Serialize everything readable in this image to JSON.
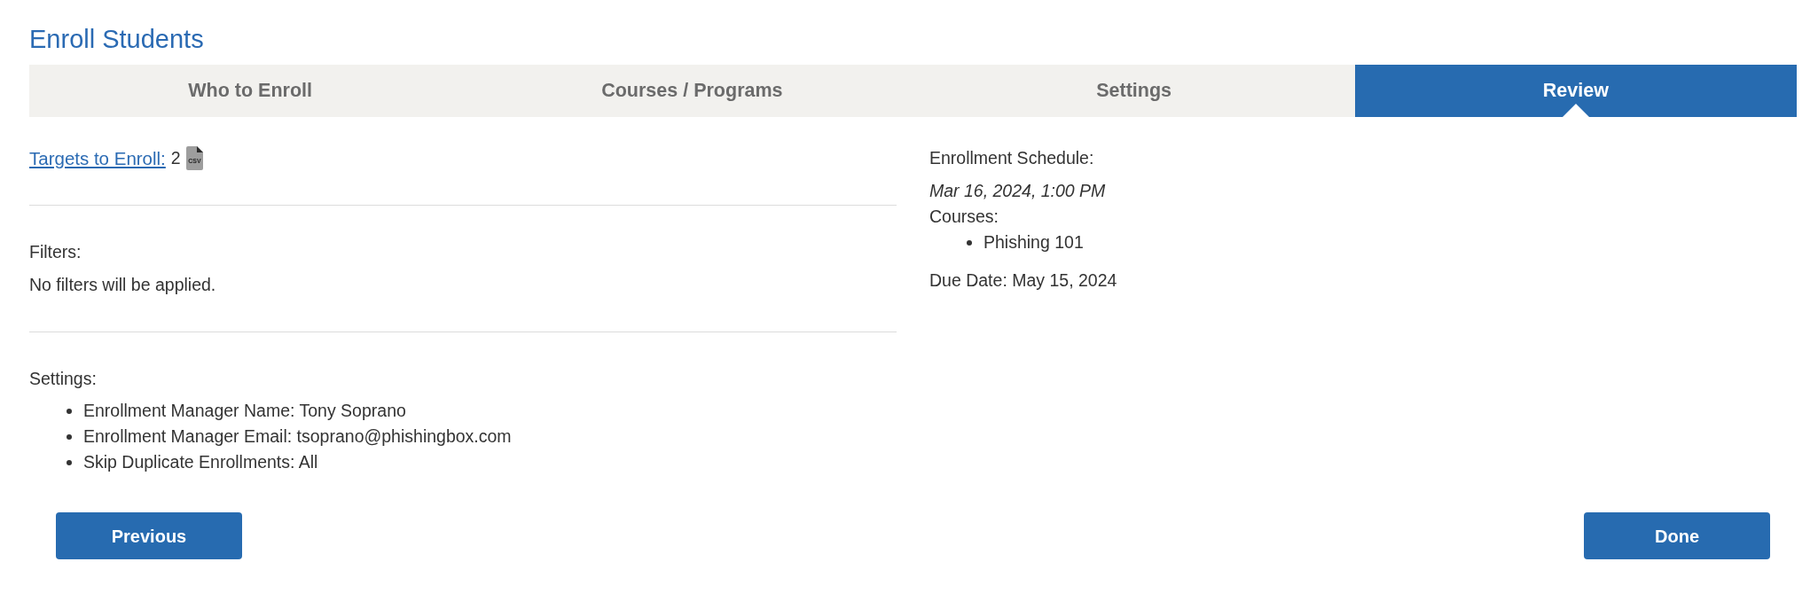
{
  "title": "Enroll Students",
  "tabs": [
    {
      "label": "Who to Enroll",
      "selected": false
    },
    {
      "label": "Courses / Programs",
      "selected": false
    },
    {
      "label": "Settings",
      "selected": false
    },
    {
      "label": "Review",
      "selected": true
    }
  ],
  "targets": {
    "label": "Targets to Enroll:",
    "count": "2",
    "file_icon_text": "CSV"
  },
  "filters": {
    "heading": "Filters:",
    "text": "No filters will be applied."
  },
  "settings": {
    "heading": "Settings:",
    "items": [
      "Enrollment Manager Name: Tony Soprano",
      "Enrollment Manager Email: tsoprano@phishingbox.com",
      "Skip Duplicate Enrollments: All"
    ]
  },
  "schedule": {
    "heading": "Enrollment Schedule:",
    "date": "Mar 16, 2024, 1:00 PM",
    "courses_label": "Courses:",
    "courses": [
      "Phishing 101"
    ],
    "due_date": "Due Date: May 15, 2024"
  },
  "buttons": {
    "previous": "Previous",
    "done": "Done"
  }
}
